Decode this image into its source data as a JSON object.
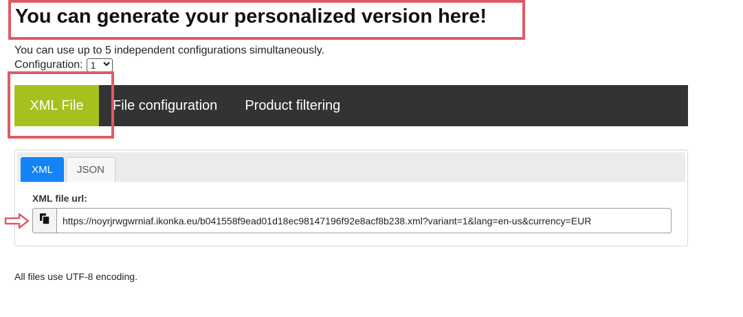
{
  "header": {
    "title": "You can generate your personalized version here!",
    "intro": "You can use up to 5 independent configurations simultaneously.",
    "config_label": "Configuration:",
    "config_value": "1"
  },
  "main_tabs": [
    {
      "label": "XML File",
      "active": true
    },
    {
      "label": "File configuration",
      "active": false
    },
    {
      "label": "Product filtering",
      "active": false
    }
  ],
  "format_tabs": [
    {
      "label": "XML",
      "active": true
    },
    {
      "label": "JSON",
      "active": false
    }
  ],
  "url_section": {
    "label": "XML file url:",
    "value": "https://noyrjrwgwrniaf.ikonka.eu/b041558f9ead01d18ec98147196f92e8acf8b238.xml?variant=1&lang=en-us&currency=EUR",
    "copy_icon": "copy-icon"
  },
  "footer": {
    "note": "All files use UTF-8 encoding."
  },
  "colors": {
    "highlight": "#e05a66",
    "active_main_tab": "#a4c11e",
    "nav_bg": "#333333",
    "active_sub_tab": "#1383f5"
  }
}
